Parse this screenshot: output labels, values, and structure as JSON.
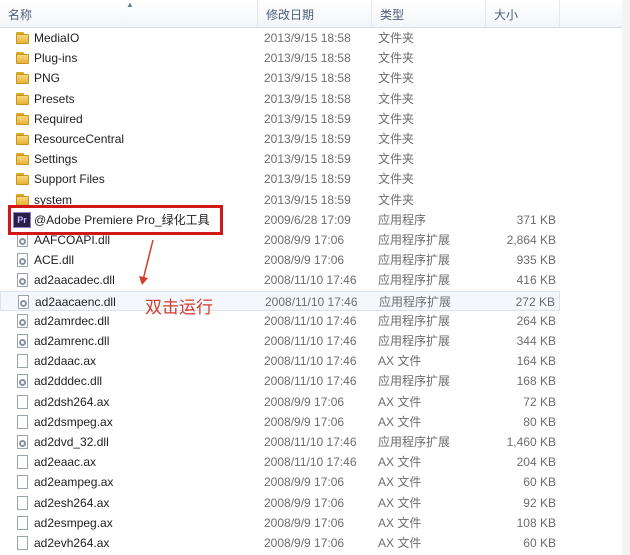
{
  "columns": {
    "name": "名称",
    "date": "修改日期",
    "type": "类型",
    "size": "大小"
  },
  "annotation": "双击运行",
  "rows": [
    {
      "name": "MediaIO",
      "date": "2013/9/15 18:58",
      "type": "文件夹",
      "size": "",
      "icon": "folder-icon"
    },
    {
      "name": "Plug-ins",
      "date": "2013/9/15 18:58",
      "type": "文件夹",
      "size": "",
      "icon": "folder-icon"
    },
    {
      "name": "PNG",
      "date": "2013/9/15 18:58",
      "type": "文件夹",
      "size": "",
      "icon": "folder-icon"
    },
    {
      "name": "Presets",
      "date": "2013/9/15 18:58",
      "type": "文件夹",
      "size": "",
      "icon": "folder-icon"
    },
    {
      "name": "Required",
      "date": "2013/9/15 18:59",
      "type": "文件夹",
      "size": "",
      "icon": "folder-icon"
    },
    {
      "name": "ResourceCentral",
      "date": "2013/9/15 18:59",
      "type": "文件夹",
      "size": "",
      "icon": "folder-icon"
    },
    {
      "name": "Settings",
      "date": "2013/9/15 18:59",
      "type": "文件夹",
      "size": "",
      "icon": "folder-icon"
    },
    {
      "name": "Support Files",
      "date": "2013/9/15 18:59",
      "type": "文件夹",
      "size": "",
      "icon": "folder-icon"
    },
    {
      "name": "system",
      "date": "2013/9/15 18:59",
      "type": "文件夹",
      "size": "",
      "icon": "folder-icon"
    },
    {
      "name": "@Adobe Premiere Pro_绿化工具",
      "date": "2009/6/28 17:09",
      "type": "应用程序",
      "size": "371 KB",
      "icon": "premiere-icon"
    },
    {
      "name": "AAFCOAPI.dll",
      "date": "2008/9/9 17:06",
      "type": "应用程序扩展",
      "size": "2,864 KB",
      "icon": "dll-icon"
    },
    {
      "name": "ACE.dll",
      "date": "2008/9/9 17:06",
      "type": "应用程序扩展",
      "size": "935 KB",
      "icon": "dll-icon"
    },
    {
      "name": "ad2aacadec.dll",
      "date": "2008/11/10 17:46",
      "type": "应用程序扩展",
      "size": "416 KB",
      "icon": "dll-icon"
    },
    {
      "name": "ad2aacaenc.dll",
      "date": "2008/11/10 17:46",
      "type": "应用程序扩展",
      "size": "272 KB",
      "icon": "dll-icon"
    },
    {
      "name": "ad2amrdec.dll",
      "date": "2008/11/10 17:46",
      "type": "应用程序扩展",
      "size": "264 KB",
      "icon": "dll-icon"
    },
    {
      "name": "ad2amrenc.dll",
      "date": "2008/11/10 17:46",
      "type": "应用程序扩展",
      "size": "344 KB",
      "icon": "dll-icon"
    },
    {
      "name": "ad2daac.ax",
      "date": "2008/11/10 17:46",
      "type": "AX 文件",
      "size": "164 KB",
      "icon": "file-icon"
    },
    {
      "name": "ad2dddec.dll",
      "date": "2008/11/10 17:46",
      "type": "应用程序扩展",
      "size": "168 KB",
      "icon": "dll-icon"
    },
    {
      "name": "ad2dsh264.ax",
      "date": "2008/9/9 17:06",
      "type": "AX 文件",
      "size": "72 KB",
      "icon": "file-icon"
    },
    {
      "name": "ad2dsmpeg.ax",
      "date": "2008/9/9 17:06",
      "type": "AX 文件",
      "size": "80 KB",
      "icon": "file-icon"
    },
    {
      "name": "ad2dvd_32.dll",
      "date": "2008/11/10 17:46",
      "type": "应用程序扩展",
      "size": "1,460 KB",
      "icon": "dll-icon"
    },
    {
      "name": "ad2eaac.ax",
      "date": "2008/11/10 17:46",
      "type": "AX 文件",
      "size": "204 KB",
      "icon": "file-icon"
    },
    {
      "name": "ad2eampeg.ax",
      "date": "2008/9/9 17:06",
      "type": "AX 文件",
      "size": "60 KB",
      "icon": "file-icon"
    },
    {
      "name": "ad2esh264.ax",
      "date": "2008/9/9 17:06",
      "type": "AX 文件",
      "size": "92 KB",
      "icon": "file-icon"
    },
    {
      "name": "ad2esmpeg.ax",
      "date": "2008/9/9 17:06",
      "type": "AX 文件",
      "size": "108 KB",
      "icon": "file-icon"
    },
    {
      "name": "ad2evh264.ax",
      "date": "2008/9/9 17:06",
      "type": "AX 文件",
      "size": "60 KB",
      "icon": "file-icon"
    }
  ]
}
